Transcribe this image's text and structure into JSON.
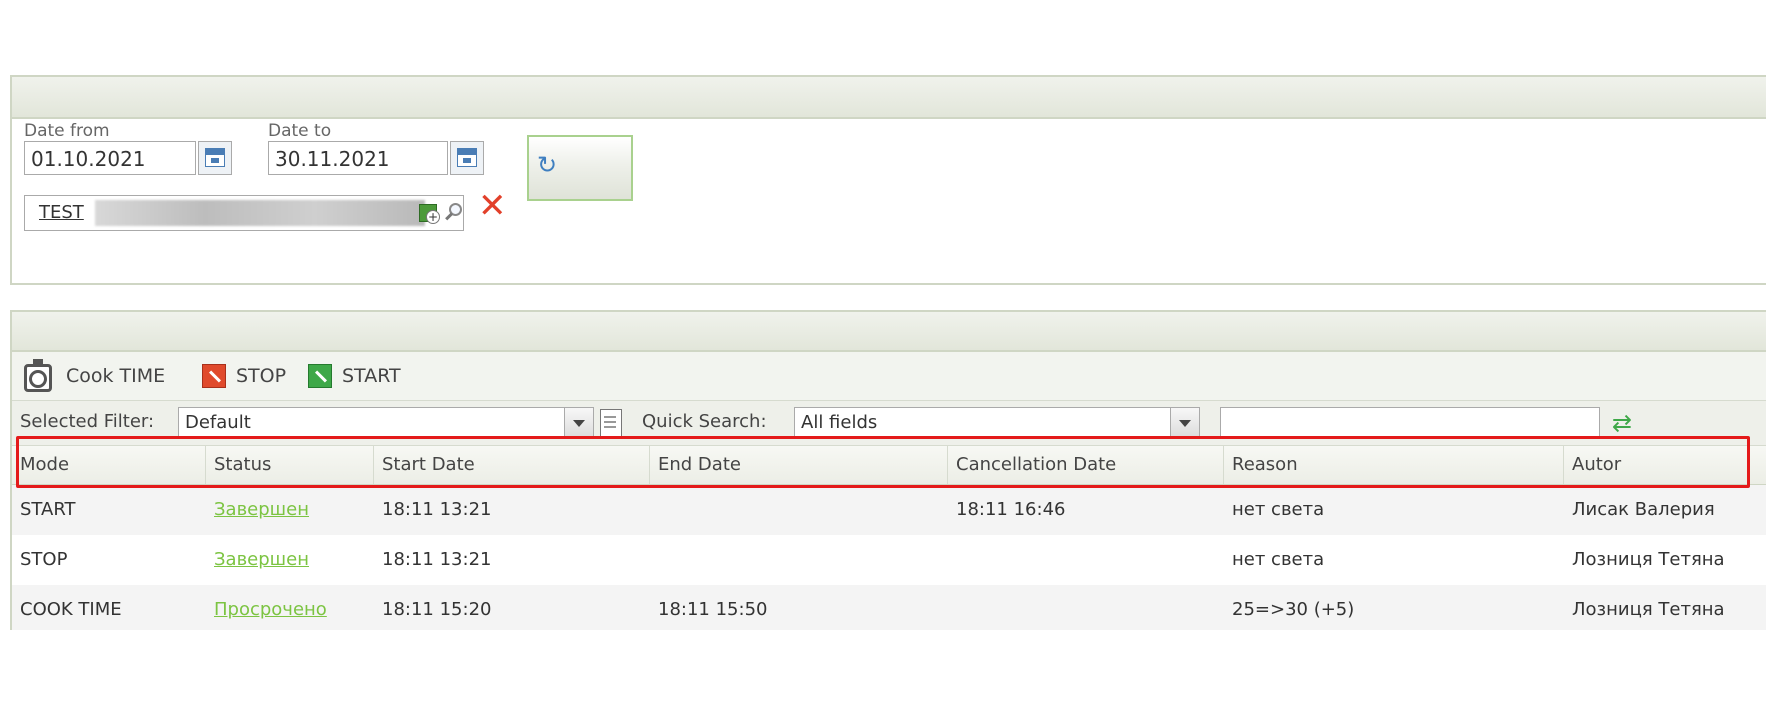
{
  "filters": {
    "date_from_label": "Date from",
    "date_from_value": "01.10.2021",
    "date_to_label": "Date to",
    "date_to_value": "30.11.2021",
    "object_value": "TEST"
  },
  "toolbar": {
    "cook_time_label": "Cook TIME",
    "stop_label": "STOP",
    "start_label": "START"
  },
  "filter_row": {
    "selected_filter_label": "Selected Filter:",
    "selected_filter_value": "Default",
    "quick_search_label": "Quick Search:",
    "quick_search_field": "All fields",
    "quick_search_text": ""
  },
  "table": {
    "columns": [
      "Mode",
      "Status",
      "Start Date",
      "End Date",
      "Cancellation Date",
      "Reason",
      "Autor"
    ],
    "rows": [
      {
        "mode": "START",
        "status": "Завершен",
        "start": "18:11 13:21",
        "end": "",
        "cancel": "18:11 16:46",
        "reason": "нет света",
        "autor": "Лисак Валерия"
      },
      {
        "mode": "STOP",
        "status": "Завершен",
        "start": "18:11 13:21",
        "end": "",
        "cancel": "",
        "reason": "нет света",
        "autor": "Лозниця Тетяна"
      },
      {
        "mode": "COOK TIME",
        "status": "Просрочено",
        "start": "18:11 15:20",
        "end": "18:11 15:50",
        "cancel": "",
        "reason": "25=>30 (+5)",
        "autor": "Лозниця Тетяна"
      }
    ]
  },
  "colors": {
    "status_link": "#7cc442",
    "highlight": "#e41a1a",
    "stop_icon": "#e04a2c",
    "start_icon": "#3ea848"
  }
}
